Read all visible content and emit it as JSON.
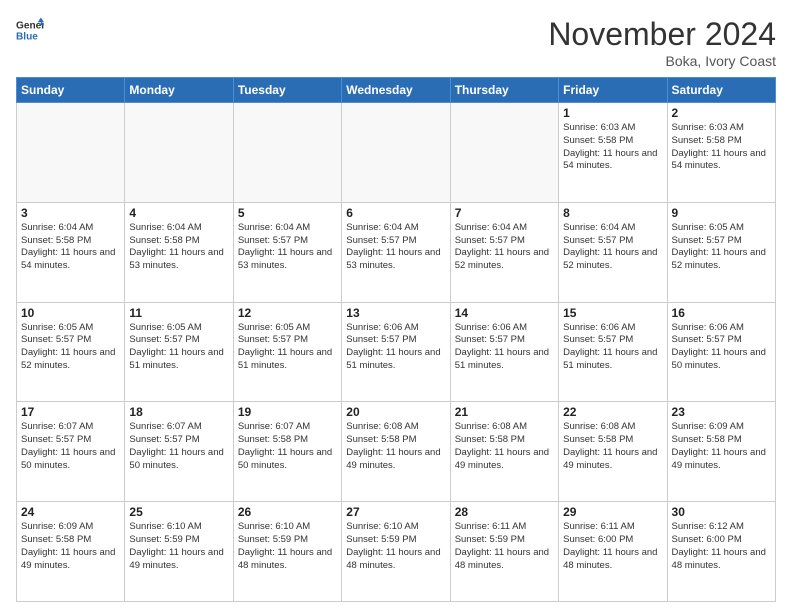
{
  "header": {
    "logo_line1": "General",
    "logo_line2": "Blue",
    "month": "November 2024",
    "location": "Boka, Ivory Coast"
  },
  "weekdays": [
    "Sunday",
    "Monday",
    "Tuesday",
    "Wednesday",
    "Thursday",
    "Friday",
    "Saturday"
  ],
  "weeks": [
    [
      {
        "day": "",
        "info": ""
      },
      {
        "day": "",
        "info": ""
      },
      {
        "day": "",
        "info": ""
      },
      {
        "day": "",
        "info": ""
      },
      {
        "day": "",
        "info": ""
      },
      {
        "day": "1",
        "info": "Sunrise: 6:03 AM\nSunset: 5:58 PM\nDaylight: 11 hours\nand 54 minutes."
      },
      {
        "day": "2",
        "info": "Sunrise: 6:03 AM\nSunset: 5:58 PM\nDaylight: 11 hours\nand 54 minutes."
      }
    ],
    [
      {
        "day": "3",
        "info": "Sunrise: 6:04 AM\nSunset: 5:58 PM\nDaylight: 11 hours\nand 54 minutes."
      },
      {
        "day": "4",
        "info": "Sunrise: 6:04 AM\nSunset: 5:58 PM\nDaylight: 11 hours\nand 53 minutes."
      },
      {
        "day": "5",
        "info": "Sunrise: 6:04 AM\nSunset: 5:57 PM\nDaylight: 11 hours\nand 53 minutes."
      },
      {
        "day": "6",
        "info": "Sunrise: 6:04 AM\nSunset: 5:57 PM\nDaylight: 11 hours\nand 53 minutes."
      },
      {
        "day": "7",
        "info": "Sunrise: 6:04 AM\nSunset: 5:57 PM\nDaylight: 11 hours\nand 52 minutes."
      },
      {
        "day": "8",
        "info": "Sunrise: 6:04 AM\nSunset: 5:57 PM\nDaylight: 11 hours\nand 52 minutes."
      },
      {
        "day": "9",
        "info": "Sunrise: 6:05 AM\nSunset: 5:57 PM\nDaylight: 11 hours\nand 52 minutes."
      }
    ],
    [
      {
        "day": "10",
        "info": "Sunrise: 6:05 AM\nSunset: 5:57 PM\nDaylight: 11 hours\nand 52 minutes."
      },
      {
        "day": "11",
        "info": "Sunrise: 6:05 AM\nSunset: 5:57 PM\nDaylight: 11 hours\nand 51 minutes."
      },
      {
        "day": "12",
        "info": "Sunrise: 6:05 AM\nSunset: 5:57 PM\nDaylight: 11 hours\nand 51 minutes."
      },
      {
        "day": "13",
        "info": "Sunrise: 6:06 AM\nSunset: 5:57 PM\nDaylight: 11 hours\nand 51 minutes."
      },
      {
        "day": "14",
        "info": "Sunrise: 6:06 AM\nSunset: 5:57 PM\nDaylight: 11 hours\nand 51 minutes."
      },
      {
        "day": "15",
        "info": "Sunrise: 6:06 AM\nSunset: 5:57 PM\nDaylight: 11 hours\nand 51 minutes."
      },
      {
        "day": "16",
        "info": "Sunrise: 6:06 AM\nSunset: 5:57 PM\nDaylight: 11 hours\nand 50 minutes."
      }
    ],
    [
      {
        "day": "17",
        "info": "Sunrise: 6:07 AM\nSunset: 5:57 PM\nDaylight: 11 hours\nand 50 minutes."
      },
      {
        "day": "18",
        "info": "Sunrise: 6:07 AM\nSunset: 5:57 PM\nDaylight: 11 hours\nand 50 minutes."
      },
      {
        "day": "19",
        "info": "Sunrise: 6:07 AM\nSunset: 5:58 PM\nDaylight: 11 hours\nand 50 minutes."
      },
      {
        "day": "20",
        "info": "Sunrise: 6:08 AM\nSunset: 5:58 PM\nDaylight: 11 hours\nand 49 minutes."
      },
      {
        "day": "21",
        "info": "Sunrise: 6:08 AM\nSunset: 5:58 PM\nDaylight: 11 hours\nand 49 minutes."
      },
      {
        "day": "22",
        "info": "Sunrise: 6:08 AM\nSunset: 5:58 PM\nDaylight: 11 hours\nand 49 minutes."
      },
      {
        "day": "23",
        "info": "Sunrise: 6:09 AM\nSunset: 5:58 PM\nDaylight: 11 hours\nand 49 minutes."
      }
    ],
    [
      {
        "day": "24",
        "info": "Sunrise: 6:09 AM\nSunset: 5:58 PM\nDaylight: 11 hours\nand 49 minutes."
      },
      {
        "day": "25",
        "info": "Sunrise: 6:10 AM\nSunset: 5:59 PM\nDaylight: 11 hours\nand 49 minutes."
      },
      {
        "day": "26",
        "info": "Sunrise: 6:10 AM\nSunset: 5:59 PM\nDaylight: 11 hours\nand 48 minutes."
      },
      {
        "day": "27",
        "info": "Sunrise: 6:10 AM\nSunset: 5:59 PM\nDaylight: 11 hours\nand 48 minutes."
      },
      {
        "day": "28",
        "info": "Sunrise: 6:11 AM\nSunset: 5:59 PM\nDaylight: 11 hours\nand 48 minutes."
      },
      {
        "day": "29",
        "info": "Sunrise: 6:11 AM\nSunset: 6:00 PM\nDaylight: 11 hours\nand 48 minutes."
      },
      {
        "day": "30",
        "info": "Sunrise: 6:12 AM\nSunset: 6:00 PM\nDaylight: 11 hours\nand 48 minutes."
      }
    ]
  ]
}
